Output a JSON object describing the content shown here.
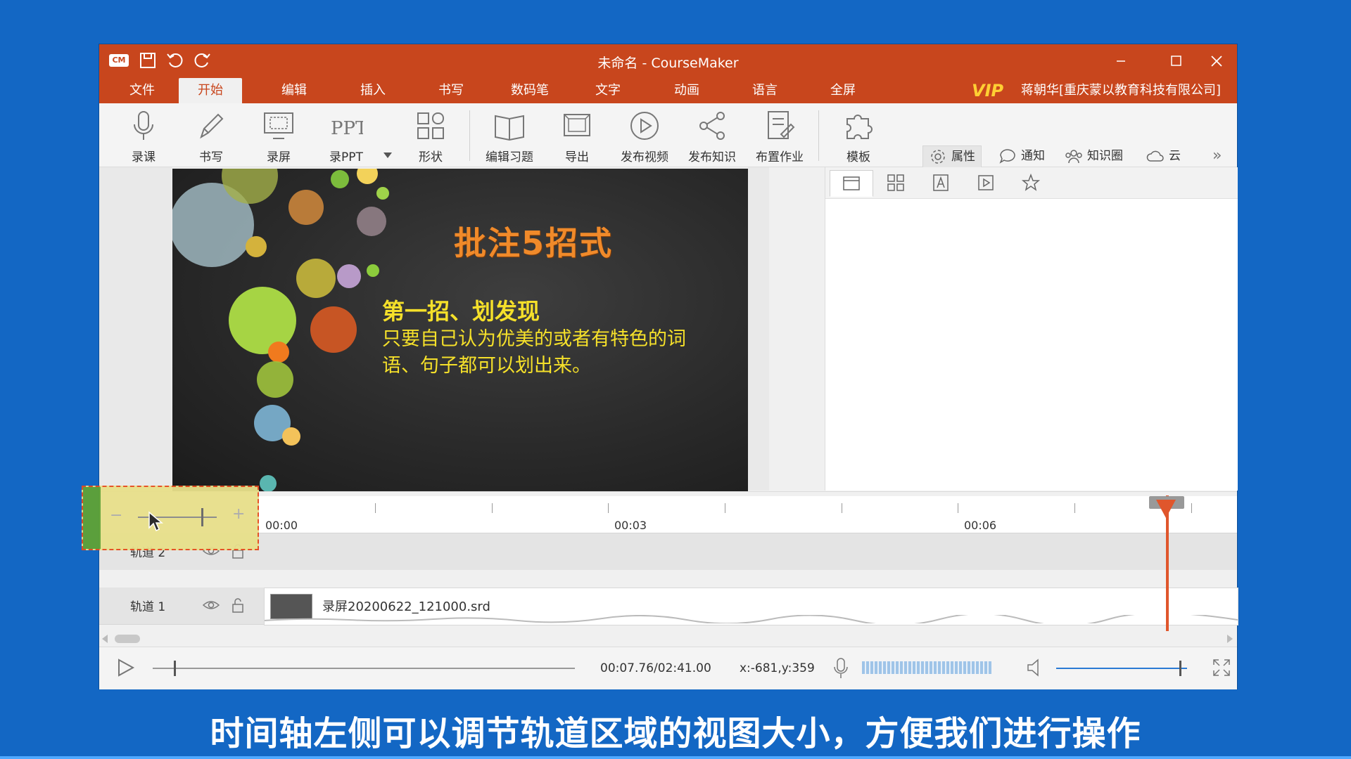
{
  "window": {
    "title": "未命名 - CourseMaker",
    "logo": "CM"
  },
  "menu": {
    "items": [
      "文件",
      "开始",
      "编辑",
      "插入",
      "书写",
      "数码笔",
      "文字",
      "动画",
      "语言",
      "全屏"
    ],
    "active": "开始",
    "vip": "VIP",
    "user": "蒋朝华[重庆蒙以教育科技有限公司]"
  },
  "toolbar": {
    "tools": [
      {
        "label": "录课",
        "icon": "microphone-icon"
      },
      {
        "label": "书写",
        "icon": "pencil-icon"
      },
      {
        "label": "录屏",
        "icon": "screen-record-icon"
      },
      {
        "label": "录PPT",
        "icon": "ppt-icon",
        "glyph": "PPT"
      },
      {
        "label": "形状",
        "icon": "shapes-icon"
      },
      {
        "label": "编辑习题",
        "icon": "book-icon"
      },
      {
        "label": "导出",
        "icon": "export-icon"
      },
      {
        "label": "发布视频",
        "icon": "play-circle-icon"
      },
      {
        "label": "发布知识",
        "icon": "share-icon"
      },
      {
        "label": "布置作业",
        "icon": "assignment-icon"
      },
      {
        "label": "模板",
        "icon": "puzzle-icon"
      }
    ],
    "right": [
      {
        "label": "属性",
        "icon": "gear-icon"
      },
      {
        "label": "通知",
        "icon": "chat-bubble-icon"
      },
      {
        "label": "知识圈",
        "icon": "group-icon"
      },
      {
        "label": "云",
        "icon": "cloud-icon"
      }
    ],
    "more": "»"
  },
  "slide": {
    "title": "批注5招式",
    "heading": "第一招、划发现",
    "body": "只要自己认为优美的或者有特色的词语、句子都可以划出来。"
  },
  "timeline": {
    "zoom_minus": "−",
    "zoom_plus": "+",
    "ruler_labels": [
      "00:00",
      "00:03",
      "00:06"
    ],
    "tracks": [
      {
        "name": "轨道 2"
      },
      {
        "name": "轨道 1"
      }
    ],
    "clip_name": "录屏20200622_121000.srd"
  },
  "playbar": {
    "time": "00:07.76/02:41.00",
    "coords": "x:-681,y:359",
    "progress": 0.05,
    "volume": 0.95
  },
  "caption": "时间轴左侧可以调节轨道区域的视图大小，方便我们进行操作",
  "colors": {
    "brand": "#c8461d",
    "background": "#1367c4",
    "playhead": "#e0562c",
    "slide_title": "#f08a2a",
    "slide_text": "#f5e02a"
  }
}
